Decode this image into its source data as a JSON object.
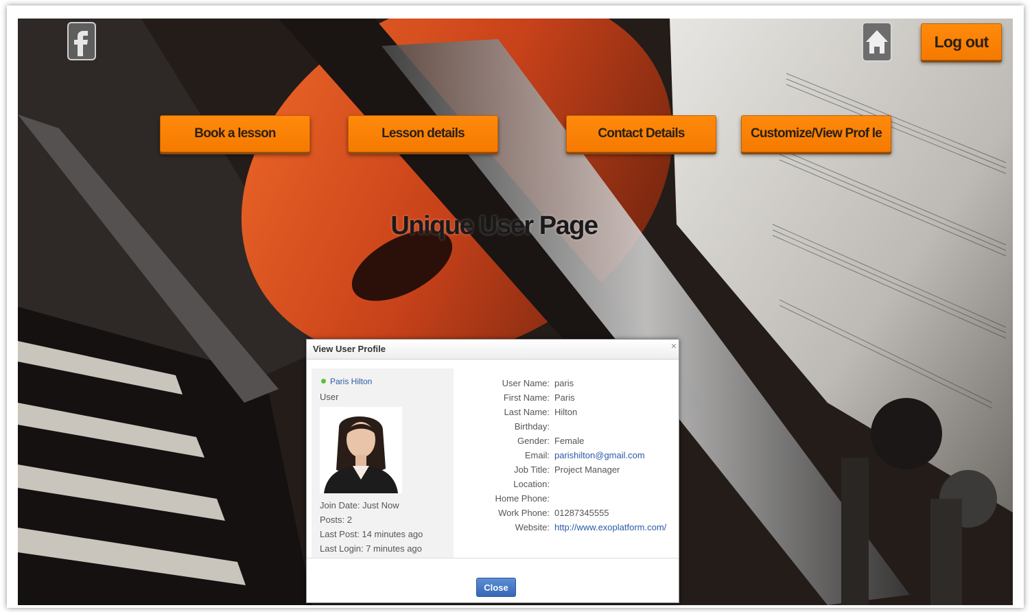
{
  "header": {
    "logout_label": "Log out"
  },
  "nav": {
    "items": [
      {
        "label": "Book a lesson"
      },
      {
        "label": "Lesson details"
      },
      {
        "label": "Contact Details"
      },
      {
        "label": "Customize/View Prof le"
      }
    ]
  },
  "page": {
    "title": "Unique User Page"
  },
  "modal": {
    "title": "View User Profile",
    "close_x": "×",
    "profile": {
      "name": "Paris Hilton",
      "role": "User",
      "online_status_color": "#5bbf3a",
      "join_date": "Join Date: Just Now",
      "posts": "Posts: 2",
      "last_post": "Last Post: 14 minutes ago",
      "last_login": "Last Login: 7 minutes ago"
    },
    "fields": [
      {
        "label": "User Name:",
        "value": "paris"
      },
      {
        "label": "First Name:",
        "value": "Paris"
      },
      {
        "label": "Last Name:",
        "value": "Hilton"
      },
      {
        "label": "Birthday:",
        "value": ""
      },
      {
        "label": "Gender:",
        "value": "Female"
      },
      {
        "label": "Email:",
        "value": "parishilton@gmail.com"
      },
      {
        "label": "Job Title:",
        "value": "Project Manager"
      },
      {
        "label": "Location:",
        "value": ""
      },
      {
        "label": "Home Phone:",
        "value": ""
      },
      {
        "label": "Work Phone:",
        "value": "01287345555"
      },
      {
        "label": "Website:",
        "value": "http://www.exoplatform.com/"
      }
    ],
    "close_label": "Close"
  },
  "icons": {
    "facebook": "facebook-icon",
    "home": "home-icon"
  },
  "colors": {
    "accent_orange": "#f57a00",
    "link_blue": "#2a5aa8",
    "close_button_blue": "#3667b6"
  }
}
